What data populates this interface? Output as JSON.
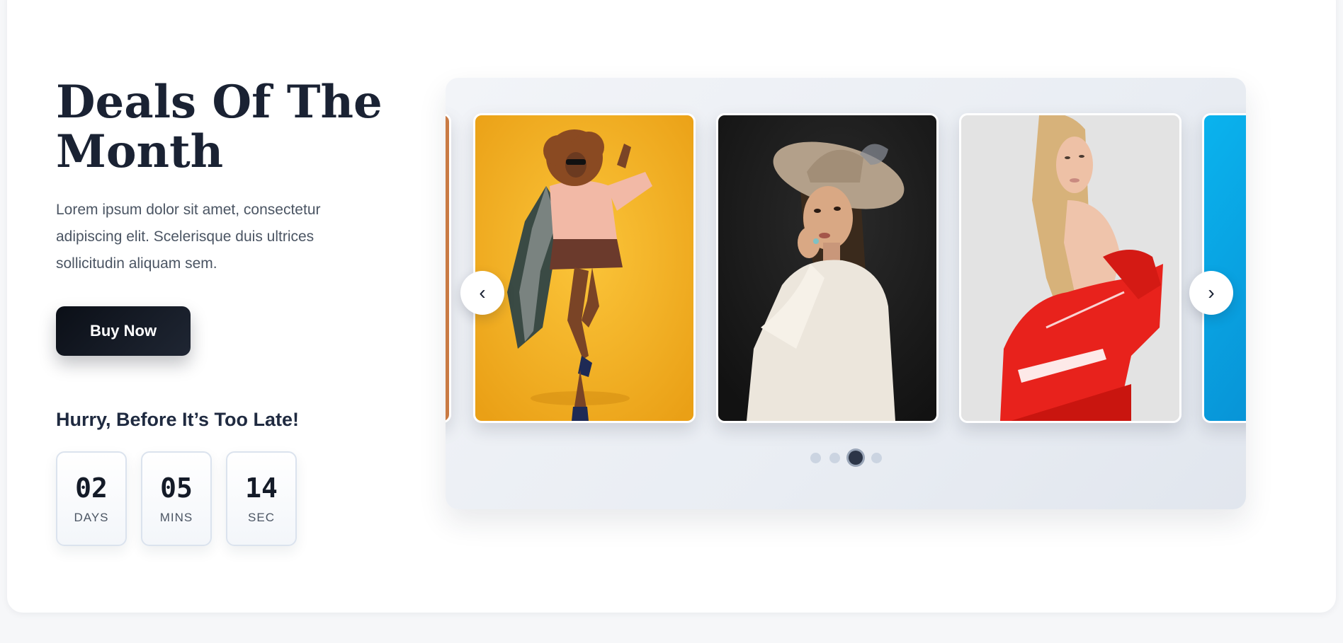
{
  "hero": {
    "title": "Deals Of The Month",
    "description": "Lorem ipsum dolor sit amet, consectetur adipiscing elit. Scelerisque duis ultrices sollicitudin aliquam sem.",
    "buy_button_label": "Buy Now"
  },
  "countdown": {
    "heading": "Hurry, Before It’s Too Late!",
    "units": [
      {
        "value": "02",
        "label": "DAYS"
      },
      {
        "value": "05",
        "label": "MINS"
      },
      {
        "value": "14",
        "label": "SEC"
      }
    ]
  },
  "carousel": {
    "prev_icon": "‹",
    "next_icon": "›",
    "slides": [
      {
        "name": "slide-partial-left",
        "bg": "#c97a44"
      },
      {
        "name": "slide-woman-yellow-background",
        "bg": "#f4b21c"
      },
      {
        "name": "slide-woman-in-hat",
        "bg": "#1f1f1f"
      },
      {
        "name": "slide-woman-red-jacket",
        "bg": "#e2e2e2"
      },
      {
        "name": "slide-partial-right",
        "bg": "#0aa3e0"
      }
    ],
    "dots_count": 4,
    "active_dot": 2
  },
  "colors": {
    "primary_dark": "#0b0f17",
    "heading": "#1a2233",
    "body_text": "#4b5563"
  }
}
